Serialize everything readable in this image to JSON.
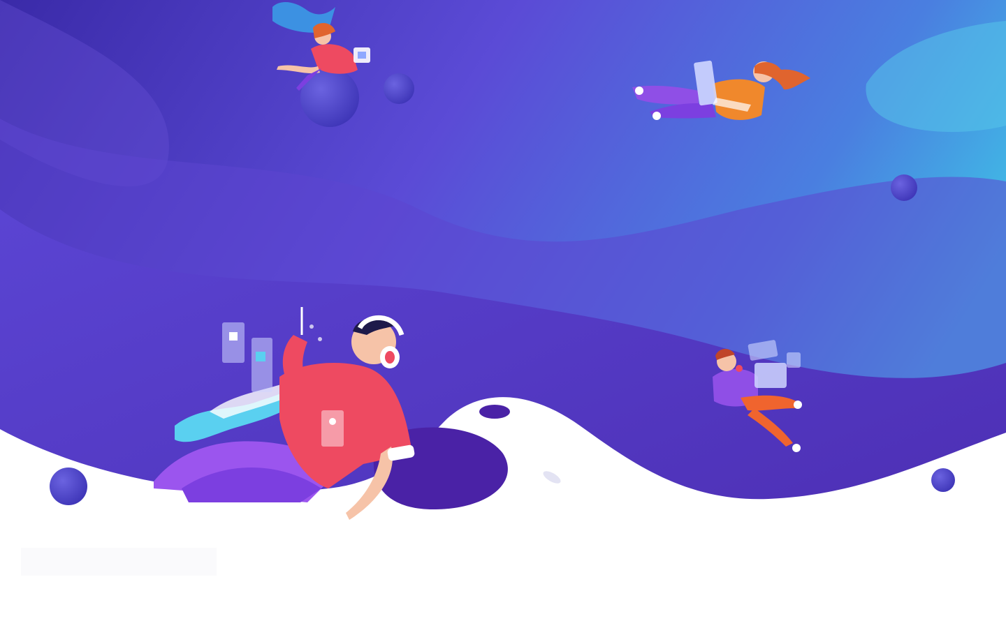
{
  "hero": {
    "colors": {
      "top_left": "#3b2bb0",
      "mid": "#5a3dd0",
      "top_right": "#3fb6e0",
      "deep": "#4a1fa0",
      "white": "#ffffff",
      "shirt": "#ef4a62",
      "pants": "#8f4fe6",
      "accent_orange": "#f07a2c",
      "orb": "#4e45c8"
    },
    "illustrations": [
      "artist-with-headphones-illustration",
      "woman-with-pen-illustration",
      "person-with-laptop-illustration",
      "developer-with-laptop-illustration"
    ]
  }
}
